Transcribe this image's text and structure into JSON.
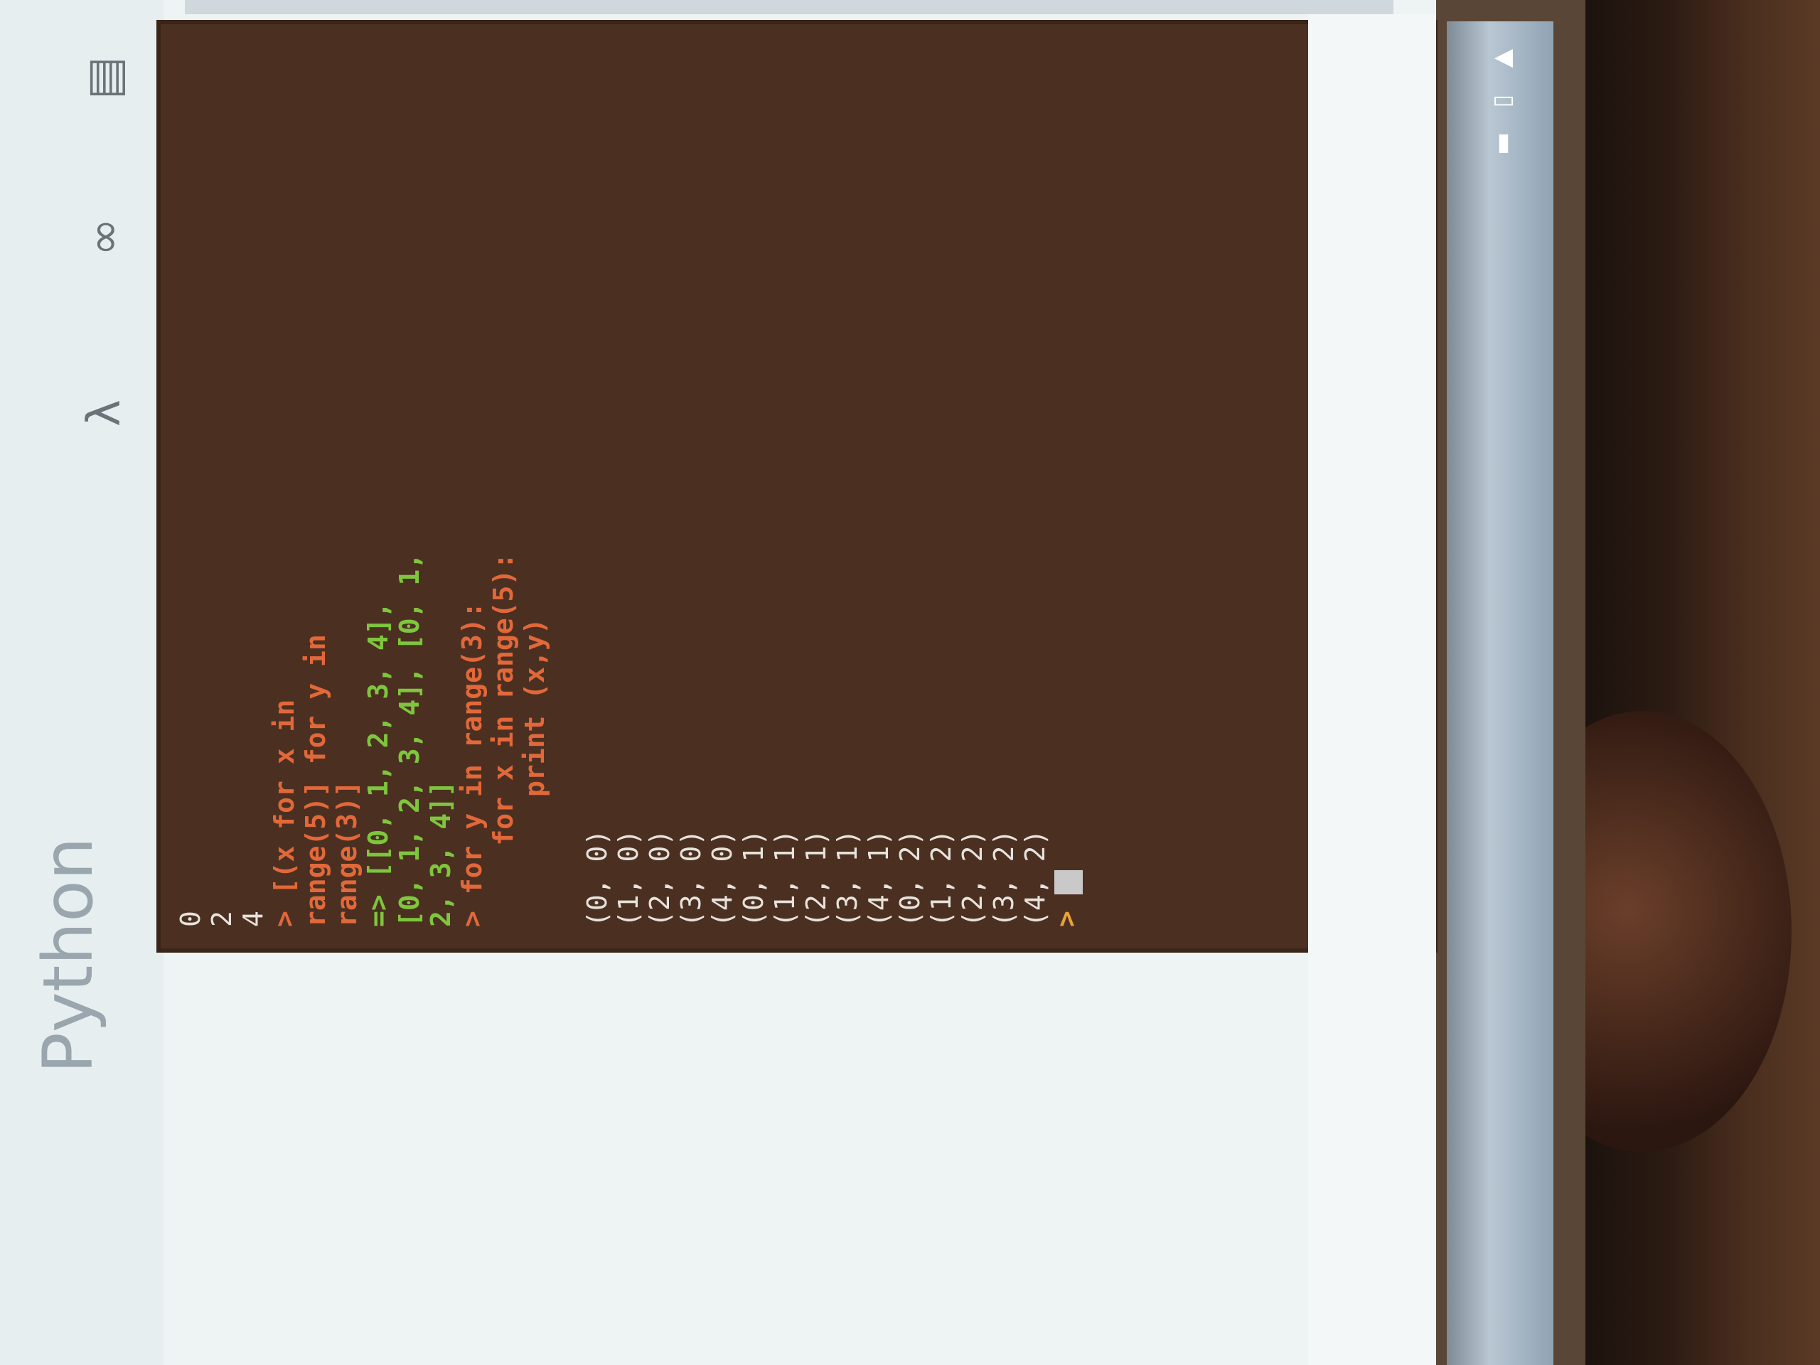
{
  "app": {
    "title": "Python"
  },
  "toolbar": {
    "icons": [
      "lambda-icon",
      "link-icon",
      "save-icon"
    ]
  },
  "console": {
    "lines": [
      {
        "kind": "out",
        "text": "0"
      },
      {
        "kind": "out",
        "text": "2"
      },
      {
        "kind": "out",
        "text": "4"
      },
      {
        "kind": "code",
        "text": "> [(x for x in"
      },
      {
        "kind": "code",
        "text": "range(5)] for y in"
      },
      {
        "kind": "code",
        "text": "range(3)]"
      },
      {
        "kind": "res",
        "text": "=> [[0, 1, 2, 3, 4],"
      },
      {
        "kind": "res",
        "text": "[0, 1, 2, 3, 4], [0, 1,"
      },
      {
        "kind": "res",
        "text": "2, 3, 4]]"
      },
      {
        "kind": "code",
        "text": "> for y in range(3):"
      },
      {
        "kind": "code",
        "text": "     for x in range(5):"
      },
      {
        "kind": "code",
        "text": "        print (x,y)"
      },
      {
        "kind": "out",
        "text": ""
      },
      {
        "kind": "out",
        "text": "(0, 0)"
      },
      {
        "kind": "out",
        "text": "(1, 0)"
      },
      {
        "kind": "out",
        "text": "(2, 0)"
      },
      {
        "kind": "out",
        "text": "(3, 0)"
      },
      {
        "kind": "out",
        "text": "(4, 0)"
      },
      {
        "kind": "out",
        "text": "(0, 1)"
      },
      {
        "kind": "out",
        "text": "(1, 1)"
      },
      {
        "kind": "out",
        "text": "(2, 1)"
      },
      {
        "kind": "out",
        "text": "(3, 1)"
      },
      {
        "kind": "out",
        "text": "(4, 1)"
      },
      {
        "kind": "out",
        "text": "(0, 2)"
      },
      {
        "kind": "out",
        "text": "(1, 2)"
      },
      {
        "kind": "out",
        "text": "(2, 2)"
      },
      {
        "kind": "out",
        "text": "(3, 2)"
      },
      {
        "kind": "out",
        "text": "(4, 2)"
      }
    ],
    "prompt": ">"
  },
  "colors": {
    "console_bg": "#4b3022",
    "code": "#e2683a",
    "result": "#7ec63d",
    "output": "#e6e2dc",
    "prompt": "#e8a23a"
  }
}
